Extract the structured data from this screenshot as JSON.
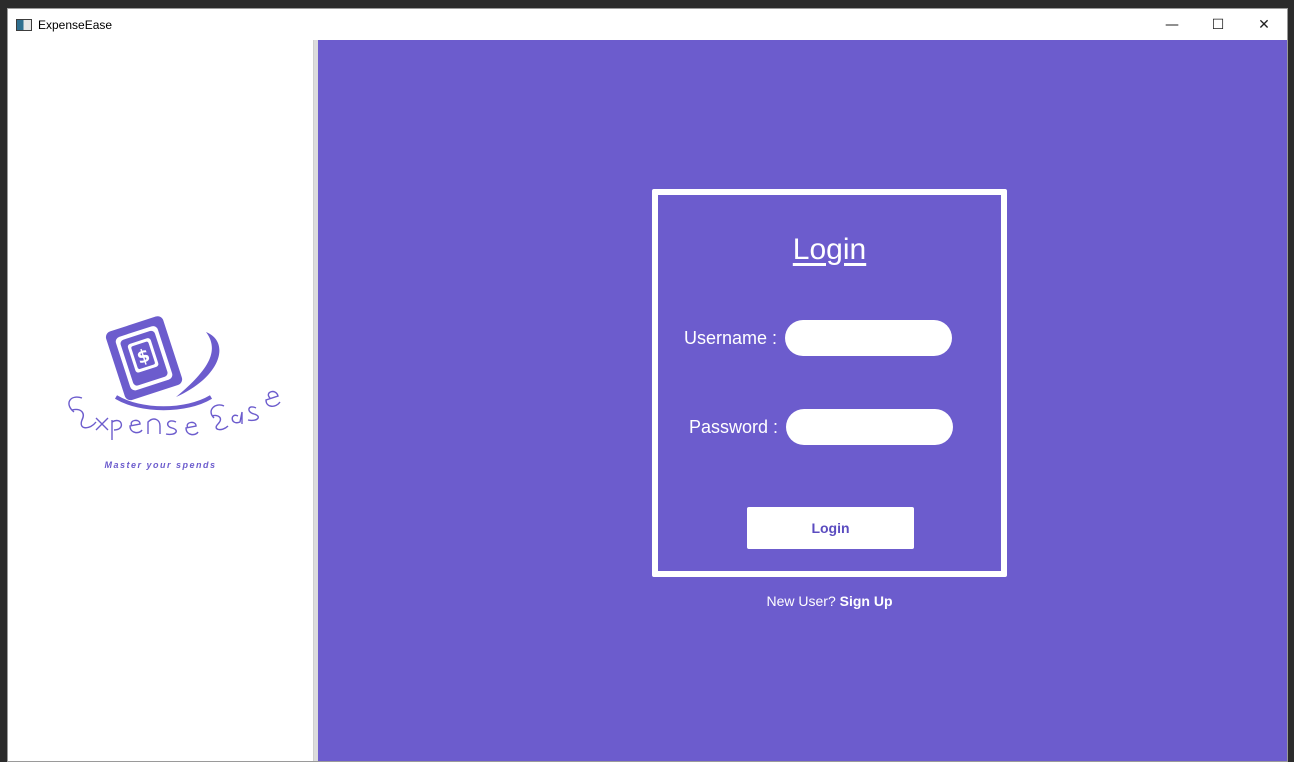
{
  "window": {
    "title": "ExpenseEase",
    "controls": {
      "minimize": "—",
      "maximize": "☐",
      "close": "✕"
    }
  },
  "sidebar": {
    "logo_text": "ExpenseEase",
    "tagline": "Master your spends"
  },
  "login": {
    "title": "Login",
    "username_label": "Username :",
    "password_label": "Password :",
    "username_value": "",
    "password_value": "",
    "button_label": "Login",
    "new_user_text": "New User?",
    "signup_link": "Sign Up"
  },
  "colors": {
    "accent": "#6c5ccd",
    "card_border": "#ffffff",
    "text_light": "#ffffff"
  }
}
